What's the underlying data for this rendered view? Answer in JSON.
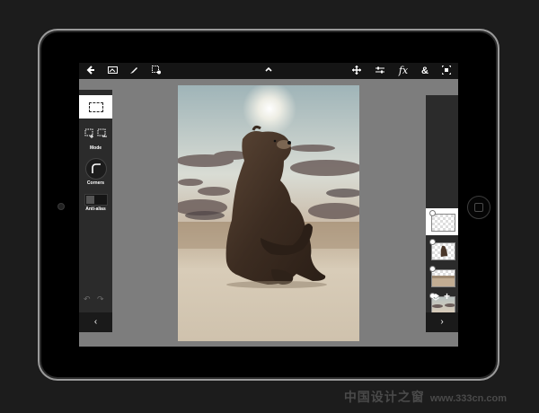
{
  "toolbar": {
    "icons": [
      "back-arrow-icon",
      "image-icon",
      "brush-icon",
      "new-image-icon",
      "collapse-up-icon",
      "move-icon",
      "adjust-icon",
      "fx-icon",
      "ampersand-icon",
      "crop-icon"
    ],
    "fx_label": "fx",
    "amp_label": "&"
  },
  "left_panel": {
    "mode_label": "Mode",
    "corners_label": "Corners",
    "antialias_label": "Anti-alias",
    "undo_label": "↶",
    "redo_label": "↷",
    "collapse_label": "‹"
  },
  "right_panel": {
    "layers": [
      {
        "name": "transparent-layer",
        "selected": true
      },
      {
        "name": "bear-layer",
        "selected": false
      },
      {
        "name": "desert-layer",
        "selected": false
      },
      {
        "name": "sky-layer",
        "selected": false
      }
    ],
    "add_label": "+",
    "collapse_label": "›"
  },
  "watermark": {
    "text": "中国设计之窗",
    "url": "www.333cn.com"
  },
  "colors": {
    "screen_bg": "#7d7d7d",
    "panel_bg": "#2b2b2b",
    "toolbar_bg": "#151515",
    "device": "#000000"
  }
}
